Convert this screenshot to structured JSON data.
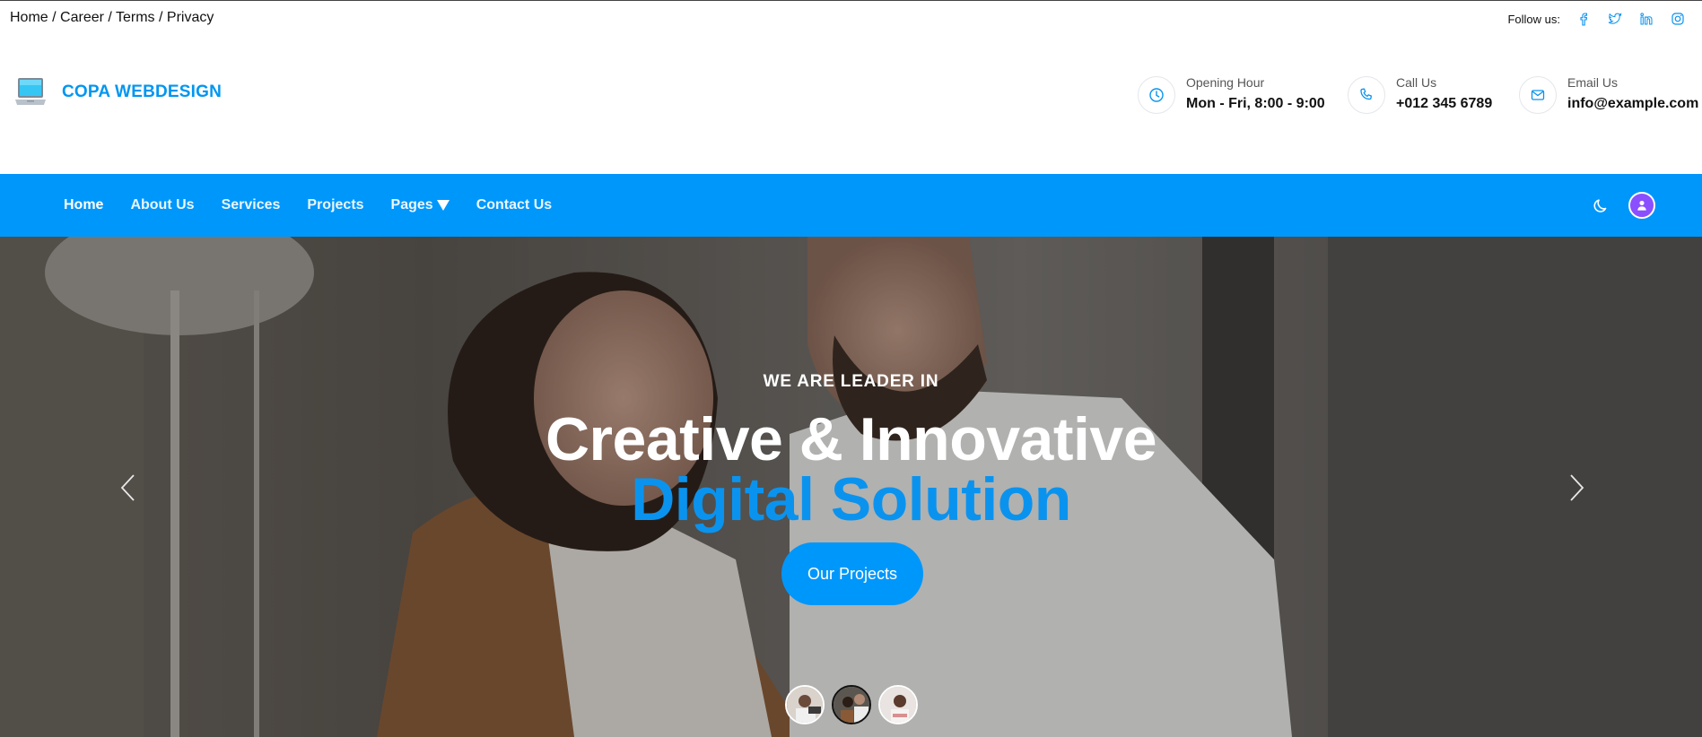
{
  "topbar": {
    "breadcrumb": [
      "Home",
      "Career",
      "Terms",
      "Privacy"
    ],
    "separator": " / ",
    "follow_label": "Follow us:",
    "socials": [
      "facebook-icon",
      "twitter-icon",
      "linkedin-icon",
      "instagram-icon"
    ]
  },
  "brand": {
    "name": "COPA WEBDESIGN",
    "logo_icon": "laptop-icon"
  },
  "contact": {
    "hours": {
      "label": "Opening Hour",
      "value": "Mon - Fri, 8:00 - 9:00",
      "icon": "clock-icon"
    },
    "phone": {
      "label": "Call Us",
      "value": "+012 345 6789",
      "icon": "phone-icon"
    },
    "email": {
      "label": "Email Us",
      "value": "info@example.com",
      "icon": "mail-icon"
    }
  },
  "nav": {
    "items": [
      {
        "label": "Home",
        "active": true
      },
      {
        "label": "About Us"
      },
      {
        "label": "Services"
      },
      {
        "label": "Projects"
      },
      {
        "label": "Pages",
        "dropdown": true
      },
      {
        "label": "Contact Us"
      }
    ],
    "theme_toggle_icon": "moon-icon",
    "user_icon": "user-icon"
  },
  "hero": {
    "subtitle": "WE ARE LEADER IN",
    "title_line1": "Creative & Innovative",
    "title_line2": "Digital Solution",
    "button_label": "Our Projects",
    "prev_icon": "chevron-left-icon",
    "next_icon": "chevron-right-icon",
    "slides_count": 3,
    "active_slide": 1
  },
  "colors": {
    "accent": "#0097fb",
    "brand_text": "#0096f0",
    "hero_highlight": "#0a93ee",
    "avatar": "#8a4fff"
  }
}
